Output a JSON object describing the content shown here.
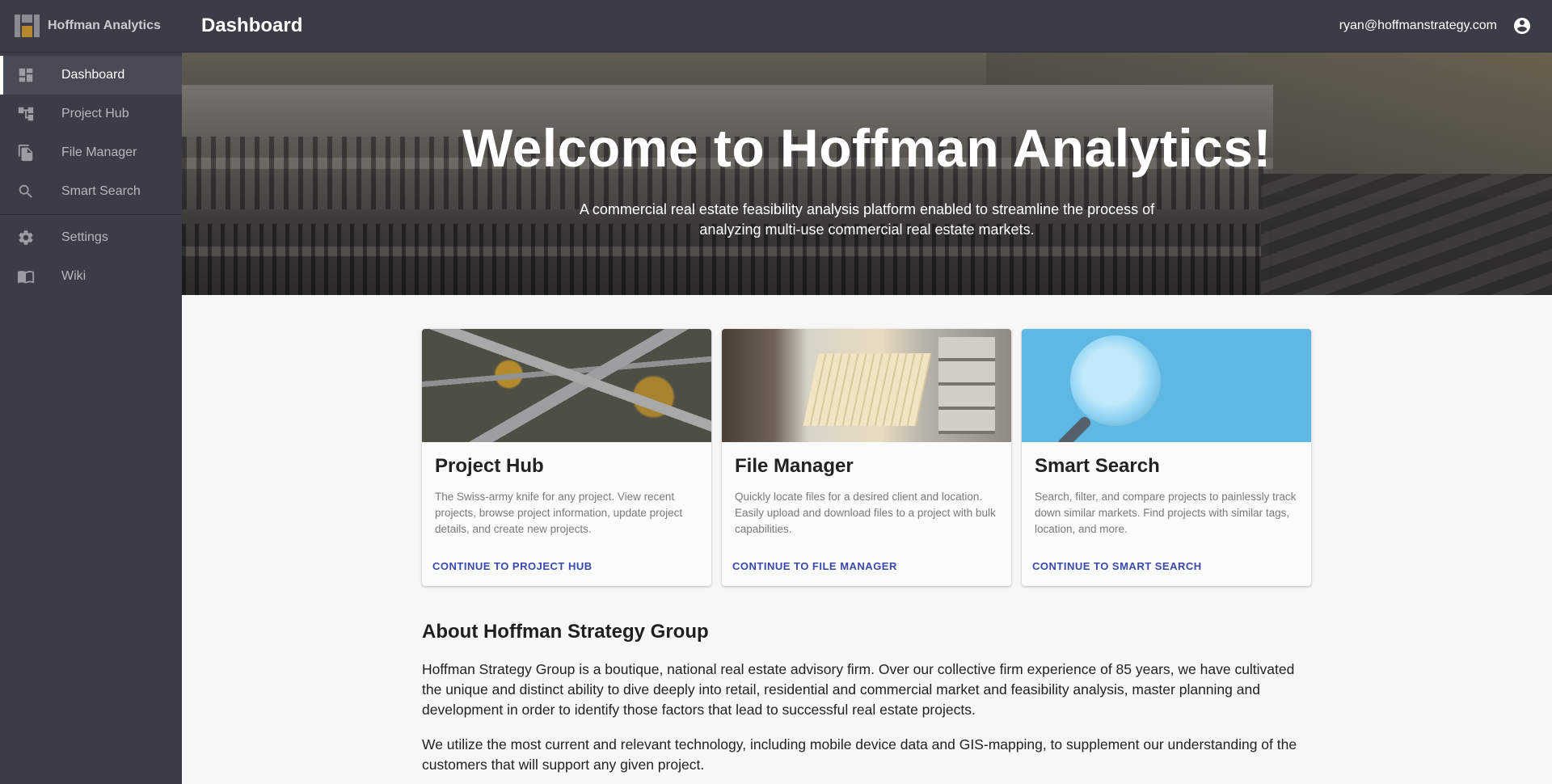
{
  "app": {
    "brand_name": "Hoffman Analytics",
    "brand_colors": {
      "logo_gray": "#8a8b90",
      "logo_gold": "#b8862b"
    }
  },
  "sidebar": {
    "items": [
      {
        "label": "Dashboard",
        "icon": "dashboard-icon",
        "active": true
      },
      {
        "label": "Project Hub",
        "icon": "project-hub-icon",
        "active": false
      },
      {
        "label": "File Manager",
        "icon": "file-manager-icon",
        "active": false
      },
      {
        "label": "Smart Search",
        "icon": "search-icon",
        "active": false
      },
      {
        "label": "Settings",
        "icon": "gear-icon",
        "active": false
      },
      {
        "label": "Wiki",
        "icon": "book-icon",
        "active": false
      }
    ]
  },
  "topbar": {
    "title": "Dashboard",
    "user_email": "ryan@hoffmanstrategy.com",
    "account_icon": "account-circle-icon"
  },
  "hero": {
    "title": "Welcome to Hoffman Analytics!",
    "subtitle": "A commercial real estate feasibility analysis platform enabled to streamline the process of analyzing multi-use commercial real estate markets."
  },
  "cards": [
    {
      "title": "Project Hub",
      "text": "The Swiss-army knife for any project. View recent projects, browse project information, update project details, and create new projects.",
      "action": "CONTINUE TO PROJECT HUB"
    },
    {
      "title": "File Manager",
      "text": "Quickly locate files for a desired client and location. Easily upload and download files to a project with bulk capabilities.",
      "action": "CONTINUE TO FILE MANAGER"
    },
    {
      "title": "Smart Search",
      "text": "Search, filter, and compare projects to painlessly track down similar markets. Find projects with similar tags, location, and more.",
      "action": "CONTINUE TO SMART SEARCH"
    }
  ],
  "about": {
    "heading": "About Hoffman Strategy Group",
    "paragraphs": [
      "Hoffman Strategy Group is a boutique, national real estate advisory firm. Over our collective firm experience of 85 years, we have cultivated the unique and distinct ability to dive deeply into retail, residential and commercial market and feasibility analysis, master planning and development in order to identify those factors that lead to successful real estate projects.",
      "We utilize the most current and relevant technology, including mobile device data and GIS-mapping, to supplement our understanding of the customers that will support any given project."
    ]
  },
  "colors": {
    "sidebar_bg": "#3a3c47",
    "accent_link": "#3949ab",
    "page_bg": "#f7f7f7"
  }
}
